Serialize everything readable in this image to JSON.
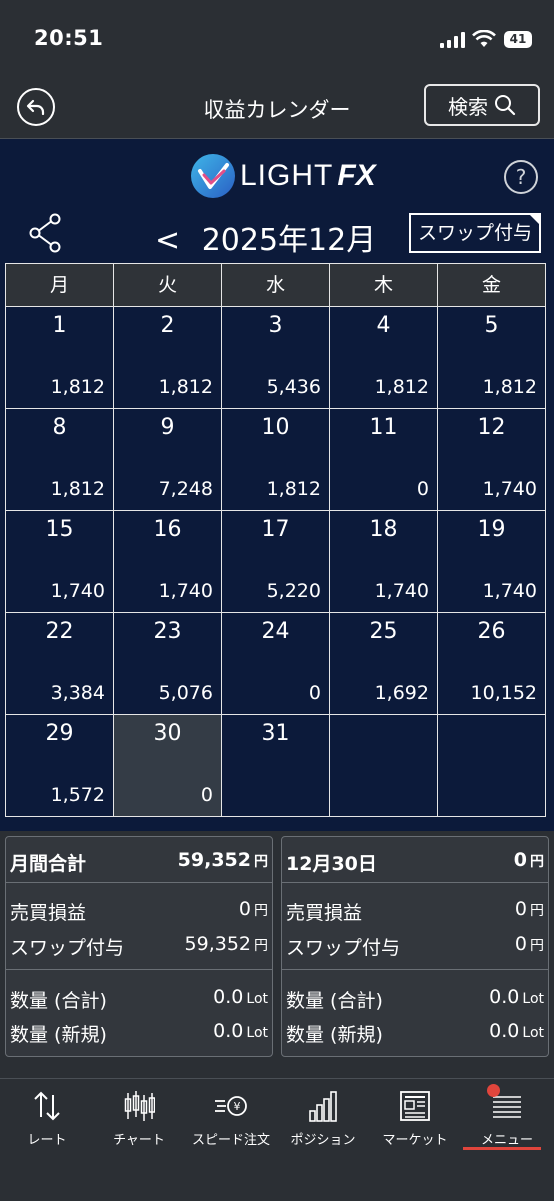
{
  "status_bar": {
    "time": "20:51",
    "battery": "41"
  },
  "header": {
    "title": "収益カレンダー",
    "search_label": "検索"
  },
  "logo": {
    "text": "LIGHT",
    "fx": "FX"
  },
  "calendar": {
    "prev_symbol": "<",
    "month_label": "2025年12月",
    "swap_button": "スワップ付与",
    "weekdays": [
      "月",
      "火",
      "水",
      "木",
      "金"
    ],
    "weeks": [
      [
        {
          "day": "1",
          "value": "1,812"
        },
        {
          "day": "2",
          "value": "1,812"
        },
        {
          "day": "3",
          "value": "5,436"
        },
        {
          "day": "4",
          "value": "1,812"
        },
        {
          "day": "5",
          "value": "1,812"
        }
      ],
      [
        {
          "day": "8",
          "value": "1,812"
        },
        {
          "day": "9",
          "value": "7,248"
        },
        {
          "day": "10",
          "value": "1,812"
        },
        {
          "day": "11",
          "value": "0"
        },
        {
          "day": "12",
          "value": "1,740"
        }
      ],
      [
        {
          "day": "15",
          "value": "1,740"
        },
        {
          "day": "16",
          "value": "1,740"
        },
        {
          "day": "17",
          "value": "5,220"
        },
        {
          "day": "18",
          "value": "1,740"
        },
        {
          "day": "19",
          "value": "1,740"
        }
      ],
      [
        {
          "day": "22",
          "value": "3,384"
        },
        {
          "day": "23",
          "value": "5,076"
        },
        {
          "day": "24",
          "value": "0"
        },
        {
          "day": "25",
          "value": "1,692"
        },
        {
          "day": "26",
          "value": "10,152"
        }
      ],
      [
        {
          "day": "29",
          "value": "1,572"
        },
        {
          "day": "30",
          "value": "0"
        },
        {
          "day": "31",
          "value": ""
        },
        {
          "day": "",
          "value": ""
        },
        {
          "day": "",
          "value": ""
        }
      ]
    ],
    "selected_day": "30"
  },
  "monthly_summary": {
    "title": "月間合計",
    "total": "59,352",
    "unit": "円",
    "trade_pl_label": "売買損益",
    "trade_pl": "0",
    "swap_label": "スワップ付与",
    "swap": "59,352",
    "qty_total_label": "数量 (合計)",
    "qty_total": "0.0",
    "qty_new_label": "数量 (新規)",
    "qty_new": "0.0",
    "lot_unit": "Lot"
  },
  "day_summary": {
    "title": "12月30日",
    "total": "0",
    "unit": "円",
    "trade_pl_label": "売買損益",
    "trade_pl": "0",
    "swap_label": "スワップ付与",
    "swap": "0",
    "qty_total_label": "数量 (合計)",
    "qty_total": "0.0",
    "qty_new_label": "数量 (新規)",
    "qty_new": "0.0",
    "lot_unit": "Lot"
  },
  "tabs": [
    {
      "label": "レート",
      "icon": "rate-arrows-icon"
    },
    {
      "label": "チャート",
      "icon": "candlestick-icon"
    },
    {
      "label": "スピード注文",
      "icon": "speed-order-icon"
    },
    {
      "label": "ポジション",
      "icon": "bar-chart-icon"
    },
    {
      "label": "マーケット",
      "icon": "newspaper-icon"
    },
    {
      "label": "メニュー",
      "icon": "menu-lines-icon"
    }
  ],
  "colors": {
    "calendar_bg": "#0c1a3a",
    "selected_cell": "#343c46",
    "accent": "#e0453c",
    "panel_bg": "#33373d"
  }
}
